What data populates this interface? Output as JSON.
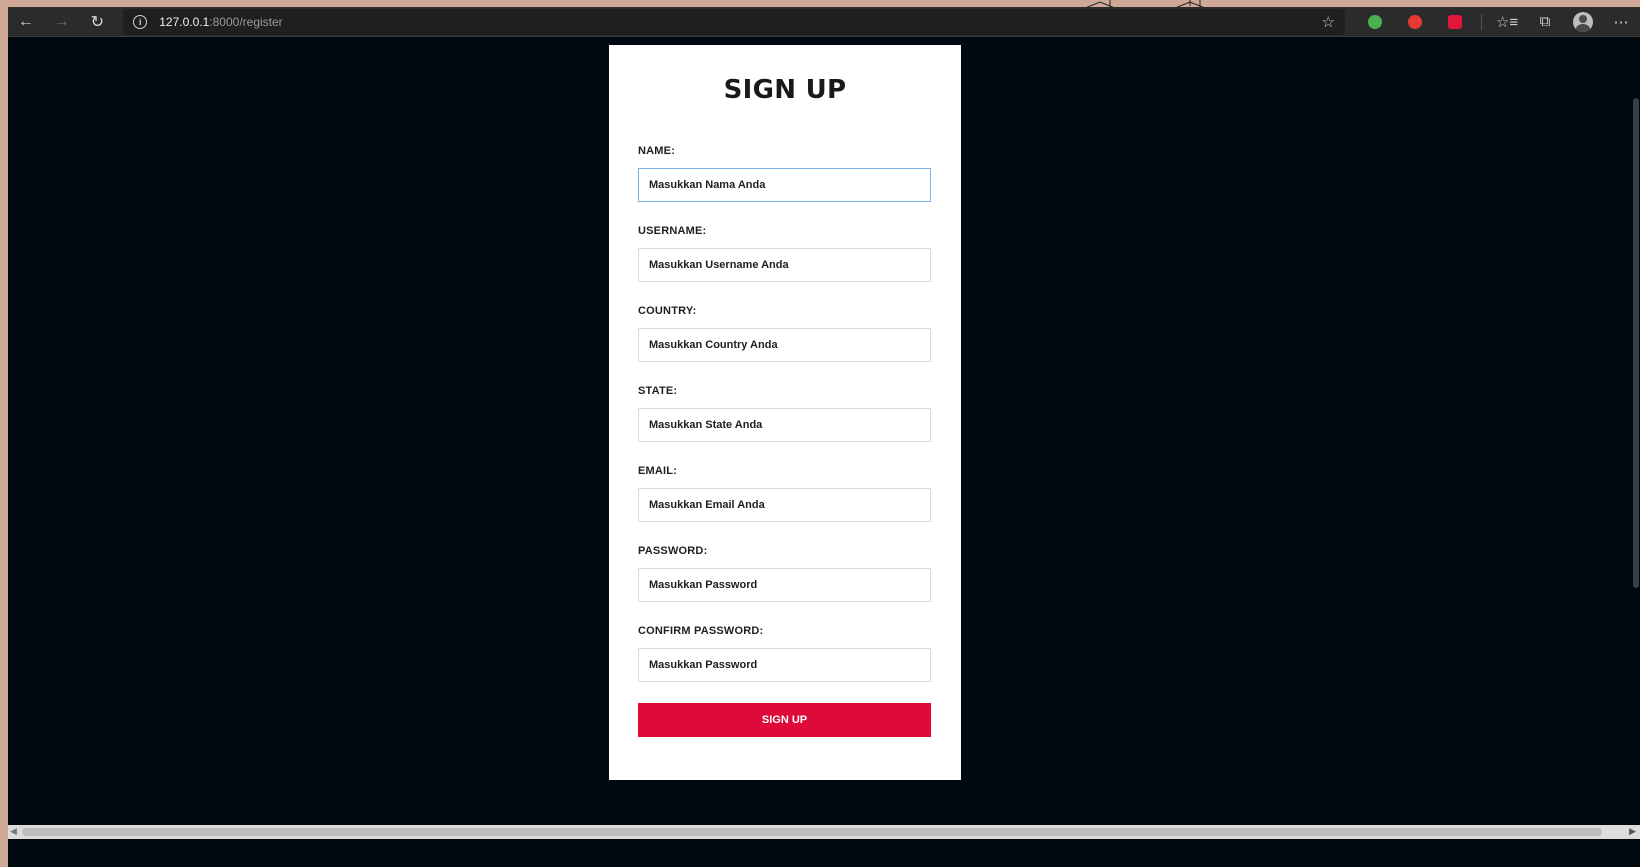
{
  "browser": {
    "url_host": "127.0.0.1",
    "url_path": ":8000/register",
    "icons": {
      "back": "back-arrow-icon",
      "forward": "forward-arrow-icon",
      "reload": "reload-icon",
      "info": "info-icon",
      "favorite": "add-favorite-icon",
      "favorites": "favorites-icon",
      "collections": "collections-icon",
      "profile": "profile-icon",
      "more": "more-icon"
    },
    "extensions": [
      {
        "name": "extension-green-icon",
        "color": "#4caf50"
      },
      {
        "name": "extension-red-hand-icon",
        "color": "#e53935"
      },
      {
        "name": "extension-red-box-icon",
        "color": "#e0163a"
      }
    ]
  },
  "form": {
    "title": "SIGN UP",
    "fields": [
      {
        "label": "NAME:",
        "placeholder": "Masukkan Nama Anda"
      },
      {
        "label": "USERNAME:",
        "placeholder": "Masukkan Username Anda"
      },
      {
        "label": "COUNTRY:",
        "placeholder": "Masukkan Country Anda"
      },
      {
        "label": "STATE:",
        "placeholder": "Masukkan State Anda"
      },
      {
        "label": "EMAIL:",
        "placeholder": "Masukkan Email Anda"
      },
      {
        "label": "PASSWORD:",
        "placeholder": "Masukkan Password"
      },
      {
        "label": "CONFIRM PASSWORD:",
        "placeholder": "Masukkan Password"
      }
    ],
    "submit_label": "SIGN UP"
  },
  "colors": {
    "page_bg": "#020812",
    "card_bg": "#ffffff",
    "button": "#dd0a3a",
    "focus_border": "#7ab3e8"
  }
}
